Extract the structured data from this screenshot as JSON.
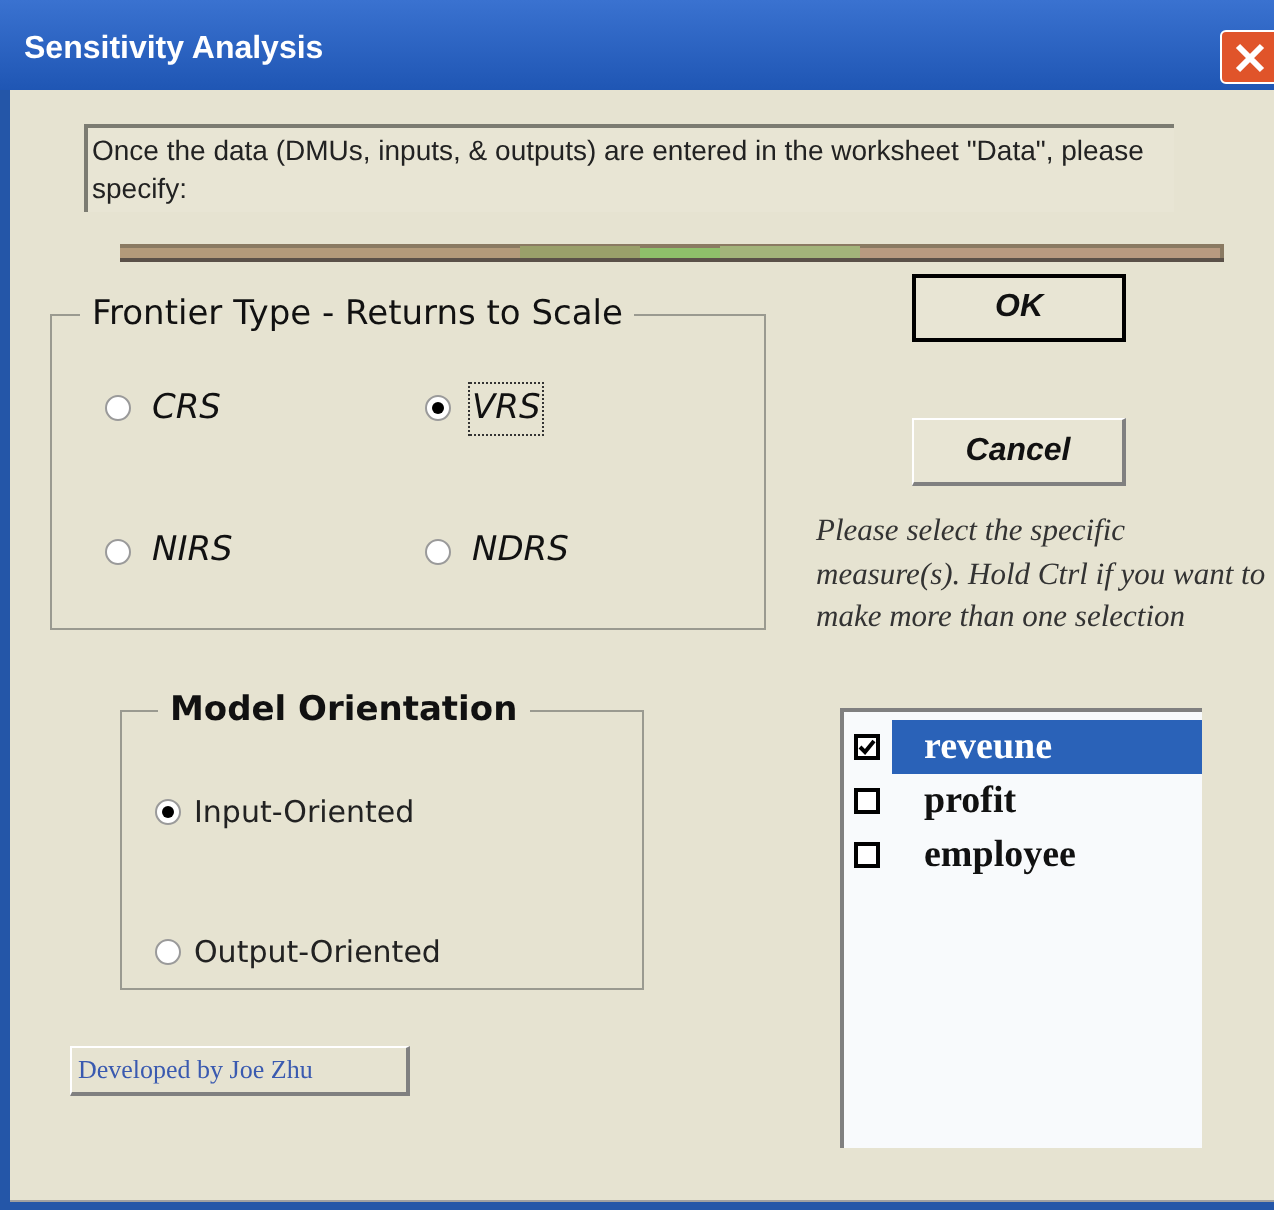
{
  "window": {
    "title": "Sensitivity Analysis"
  },
  "instructions": "Once the data (DMUs, inputs, & outputs) are entered in the worksheet \"Data\", please specify:",
  "frontier_type": {
    "title": "Frontier Type - Returns to Scale",
    "options": [
      {
        "label": "CRS",
        "selected": false,
        "focused": false
      },
      {
        "label": "VRS",
        "selected": true,
        "focused": true
      },
      {
        "label": "NIRS",
        "selected": false,
        "focused": false
      },
      {
        "label": "NDRS",
        "selected": false,
        "focused": false
      }
    ]
  },
  "model_orientation": {
    "title": "Model Orientation",
    "options": [
      {
        "label": "Input-Oriented",
        "selected": true
      },
      {
        "label": "Output-Oriented",
        "selected": false
      }
    ]
  },
  "credit_button": "Developed by Joe Zhu",
  "buttons": [
    {
      "label": "OK",
      "default": true
    },
    {
      "label": "Cancel",
      "default": false
    }
  ],
  "help_text": "Please select the specific measure(s). Hold Ctrl if you want to make more than one selection",
  "measures": [
    {
      "label": "reveune",
      "checked": true,
      "selected": true
    },
    {
      "label": "profit",
      "checked": false,
      "selected": false
    },
    {
      "label": "employee",
      "checked": false,
      "selected": false
    }
  ]
}
